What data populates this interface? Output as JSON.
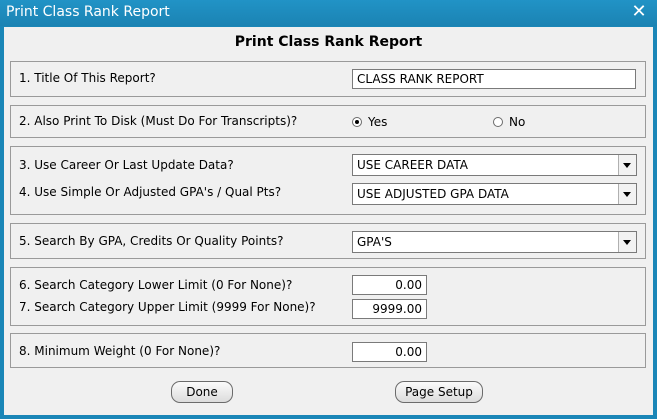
{
  "window": {
    "title": "Print Class Rank Report",
    "close_glyph": "✕"
  },
  "dialog": {
    "heading": "Print Class Rank Report"
  },
  "fields": {
    "title": {
      "label": "1. Title Of This Report?",
      "value": "CLASS RANK REPORT"
    },
    "print_to_disk": {
      "label": "2. Also Print To Disk (Must Do For Transcripts)?",
      "options": [
        "Yes",
        "No"
      ],
      "selected": "Yes"
    },
    "data_source": {
      "label": "3. Use Career Or Last Update Data?",
      "value": "USE CAREER DATA"
    },
    "gpa_type": {
      "label": "4. Use Simple Or Adjusted GPA's / Qual Pts?",
      "value": "USE ADJUSTED GPA DATA"
    },
    "search_by": {
      "label": "5. Search By GPA, Credits Or Quality Points?",
      "value": "GPA'S"
    },
    "lower_limit": {
      "label": "6. Search Category Lower Limit (0 For None)?",
      "value": "0.00"
    },
    "upper_limit": {
      "label": "7. Search Category Upper Limit (9999 For None)?",
      "value": "9999.00"
    },
    "min_weight": {
      "label": "8. Minimum Weight (0 For None)?",
      "value": "0.00"
    }
  },
  "buttons": {
    "done": "Done",
    "page_setup": "Page Setup"
  },
  "colors": {
    "titlebar": "#1a86b7",
    "client_bg": "#f0f0f0"
  }
}
